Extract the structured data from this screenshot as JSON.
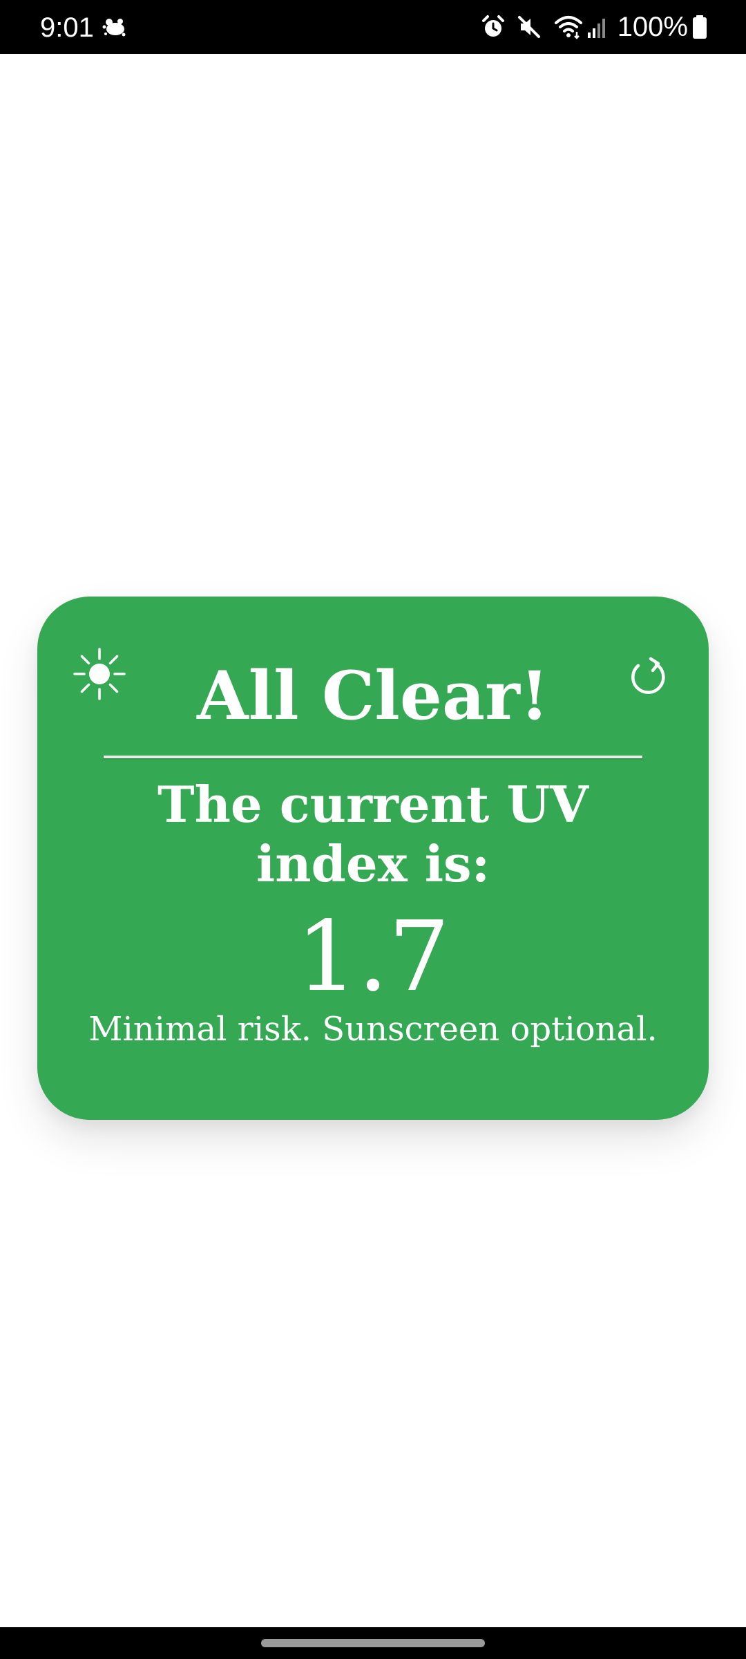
{
  "status_bar": {
    "time": "9:01",
    "left_icon": "notification-creature-icon",
    "right_icons": [
      "alarm-icon",
      "mute-icon",
      "wifi-icon",
      "signal-icon",
      "battery-icon"
    ],
    "battery": "100%"
  },
  "card": {
    "title": "All Clear!",
    "subtitle": "The current UV index is:",
    "uv_index": "1.7",
    "risk_message": "Minimal risk. Sunscreen optional.",
    "left_icon": "sun-icon",
    "right_icon": "refresh-icon",
    "color": "#34a853"
  },
  "nav_bar": {
    "handle": "home-indicator"
  }
}
